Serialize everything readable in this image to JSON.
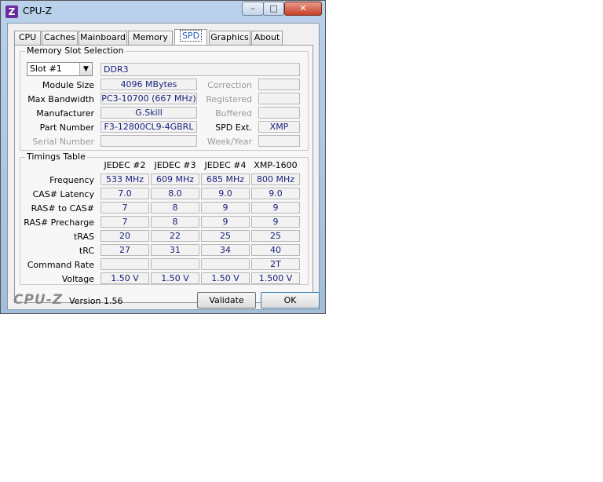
{
  "window": {
    "title": "CPU-Z",
    "icon_letter": "Z",
    "minimize": "–",
    "maximize": "□",
    "close": "✕"
  },
  "tabs": [
    {
      "label": "CPU"
    },
    {
      "label": "Caches"
    },
    {
      "label": "Mainboard"
    },
    {
      "label": "Memory"
    },
    {
      "label": "SPD",
      "active": true
    },
    {
      "label": "Graphics"
    },
    {
      "label": "About"
    }
  ],
  "slot": {
    "legend": "Memory Slot Selection",
    "selected": "Slot #1",
    "type": "DDR3",
    "module_size_label": "Module Size",
    "module_size": "4096 MBytes",
    "max_bw_label": "Max Bandwidth",
    "max_bw": "PC3-10700 (667 MHz)",
    "manufacturer_label": "Manufacturer",
    "manufacturer": "G.Skill",
    "part_label": "Part Number",
    "part": "F3-12800CL9-4GBRL",
    "serial_label": "Serial Number",
    "serial": "",
    "correction_label": "Correction",
    "correction": "",
    "registered_label": "Registered",
    "registered": "",
    "buffered_label": "Buffered",
    "buffered": "",
    "spd_ext_label": "SPD Ext.",
    "spd_ext": "XMP",
    "week_label": "Week/Year",
    "week": ""
  },
  "timings": {
    "legend": "Timings Table",
    "columns": [
      "JEDEC #2",
      "JEDEC #3",
      "JEDEC #4",
      "XMP-1600"
    ],
    "rows": [
      {
        "label": "Frequency",
        "values": [
          "533 MHz",
          "609 MHz",
          "685 MHz",
          "800 MHz"
        ]
      },
      {
        "label": "CAS# Latency",
        "values": [
          "7.0",
          "8.0",
          "9.0",
          "9.0"
        ]
      },
      {
        "label": "RAS# to CAS#",
        "values": [
          "7",
          "8",
          "9",
          "9"
        ]
      },
      {
        "label": "RAS# Precharge",
        "values": [
          "7",
          "8",
          "9",
          "9"
        ]
      },
      {
        "label": "tRAS",
        "values": [
          "20",
          "22",
          "25",
          "25"
        ]
      },
      {
        "label": "tRC",
        "values": [
          "27",
          "31",
          "34",
          "40"
        ]
      },
      {
        "label": "Command Rate",
        "values": [
          "",
          "",
          "",
          "2T"
        ]
      },
      {
        "label": "Voltage",
        "values": [
          "1.50 V",
          "1.50 V",
          "1.50 V",
          "1.500 V"
        ]
      }
    ]
  },
  "footer": {
    "logo": "CPU-Z",
    "version": "Version 1.56",
    "validate": "Validate",
    "ok": "OK"
  }
}
